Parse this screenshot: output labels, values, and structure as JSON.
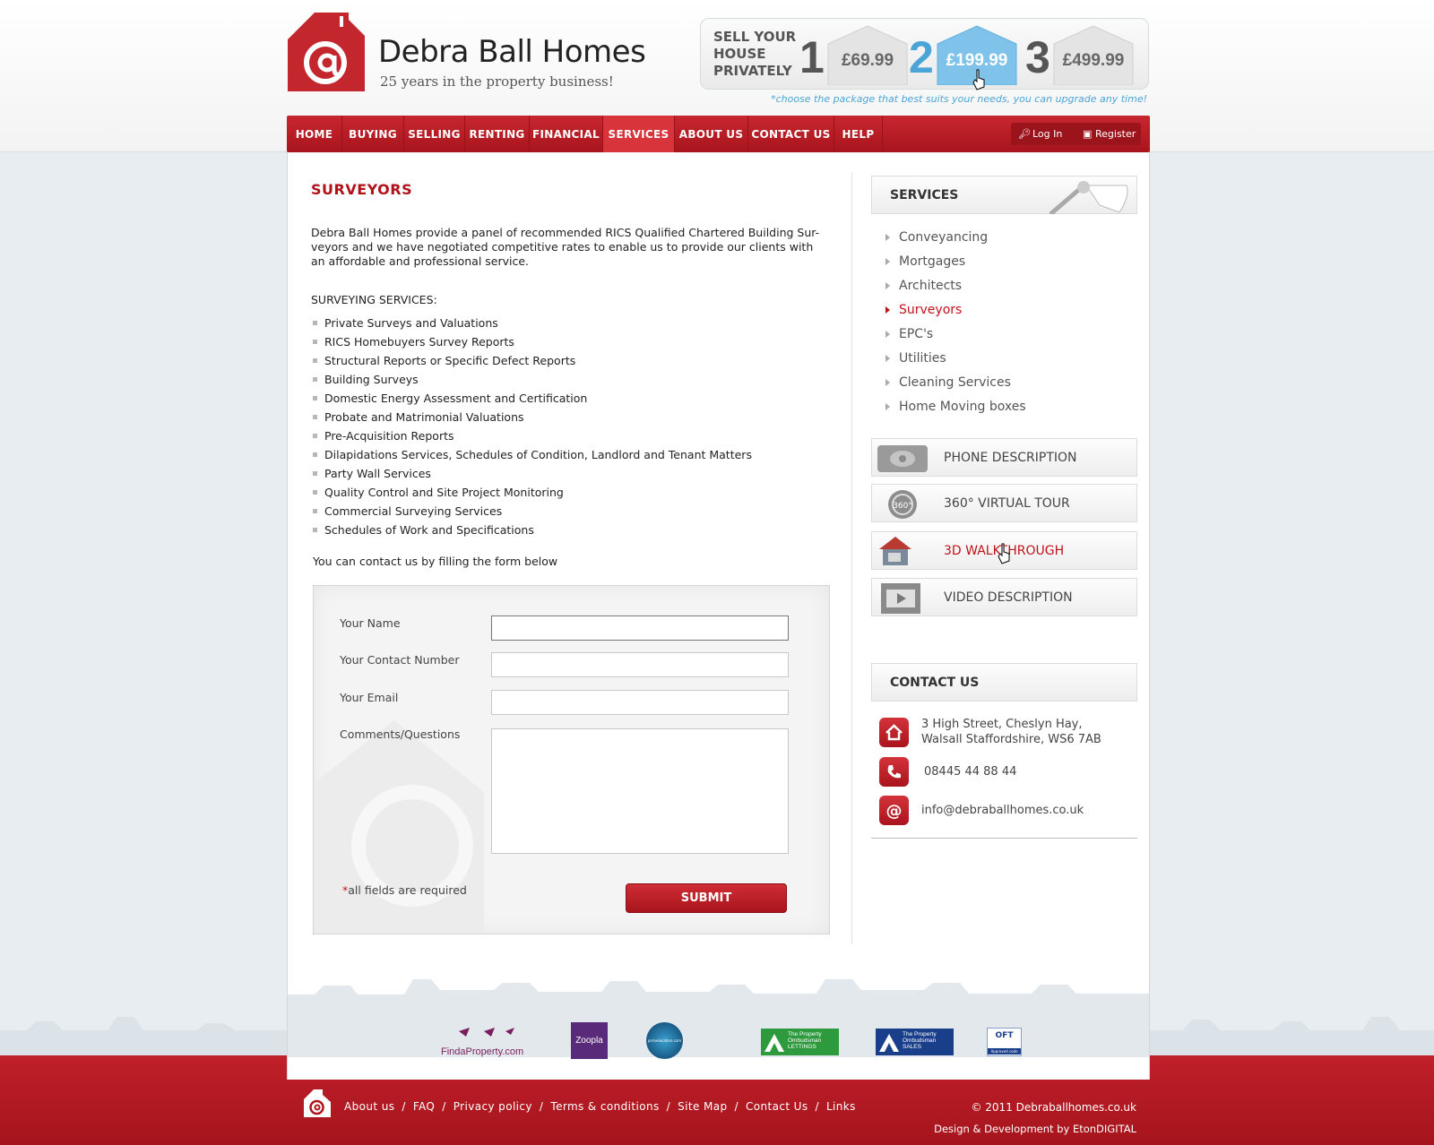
{
  "brand": {
    "name": "Debra Ball Homes",
    "tagline": "25 years in the property business!"
  },
  "pricing": {
    "label": "SELL YOUR\nHOUSE\nPRIVATELY",
    "packages": [
      {
        "number": "1",
        "price": "£69.99"
      },
      {
        "number": "2",
        "price": "£199.99"
      },
      {
        "number": "3",
        "price": "£499.99"
      }
    ],
    "note": "*choose the package that best suits your needs, you can upgrade any time!"
  },
  "nav": {
    "items": [
      "HOME",
      "BUYING",
      "SELLING",
      "RENTING",
      "FINANCIAL",
      "SERVICES",
      "ABOUT US",
      "CONTACT US",
      "HELP"
    ],
    "login": "Log In",
    "register": "Register"
  },
  "main": {
    "title": "SURVEYORS",
    "intro": "Debra Ball Homes provide a panel of recommended RICS Qualified Chartered Building Sur-veyors and we have negotiated competitive rates to enable us to provide our clients with an affordable and professional service.",
    "services_heading": "SURVEYING SERVICES:",
    "services": [
      "Private Surveys and Valuations",
      "RICS Homebuyers Survey Reports",
      "Structural Reports or Specific Defect Reports",
      "Building Surveys",
      "Domestic Energy Assessment and Certification",
      "Probate and Matrimonial Valuations",
      "Pre-Acquisition Reports",
      "Dilapidations Services, Schedules of Condition, Landlord and Tenant Matters",
      "Party Wall Services",
      "Quality Control and Site Project Monitoring",
      "Commercial Surveying Services",
      "Schedules of Work and Specifications"
    ],
    "contact_note": "You can contact us by filling the form below"
  },
  "form": {
    "name_label": "Your Name",
    "name_value": "",
    "phone_label": "Your Contact Number",
    "phone_value": "",
    "email_label": "Your Email",
    "email_value": "",
    "comments_label": "Comments/Questions",
    "comments_value": "",
    "required_star": "*",
    "required_note": "all fields are required",
    "submit_label": "SUBMIT"
  },
  "sidebar": {
    "services_title": "SERVICES",
    "services": [
      {
        "label": "Conveyancing",
        "active": false
      },
      {
        "label": "Mortgages",
        "active": false
      },
      {
        "label": "Architects",
        "active": false
      },
      {
        "label": "Surveyors",
        "active": true
      },
      {
        "label": "EPC's",
        "active": false
      },
      {
        "label": "Utilities",
        "active": false
      },
      {
        "label": "Cleaning Services",
        "active": false
      },
      {
        "label": "Home Moving boxes",
        "active": false
      }
    ],
    "features": [
      "PHONE DESCRIPTION",
      "360° VIRTUAL TOUR",
      "3D WALKTHROUGH",
      "VIDEO DESCRIPTION"
    ],
    "contact_title": "CONTACT US",
    "address_line1": "3 High Street, Cheslyn Hay,",
    "address_line2": "Walsall Staffordshire, WS6 7AB",
    "phone": "08445 44 88 44",
    "email": "info@debraballhomes.co.uk"
  },
  "partners": {
    "findaproperty": "FindaProperty.com",
    "zoopla": "Zoopla",
    "primelocation": "primelocation.com",
    "ombudsman_lettings_1": "The Property",
    "ombudsman_lettings_2": "Ombudsman",
    "ombudsman_lettings_3": "LETTINGS",
    "ombudsman_sales_3": "SALES",
    "oft": "OFT",
    "oft_sub": "Approved code"
  },
  "footer": {
    "links": [
      "About us",
      "FAQ",
      "Privacy policy",
      "Terms & conditions",
      "Site Map",
      "Contact Us",
      "Links"
    ],
    "copyright": "© 2011 Debraballhomes.co.uk",
    "credit": "Design & Development by EtonDIGITAL"
  },
  "colors": {
    "brand_red": "#b0121a",
    "accent_blue": "#4ba4d8",
    "page_bg": "#e7edf1"
  }
}
